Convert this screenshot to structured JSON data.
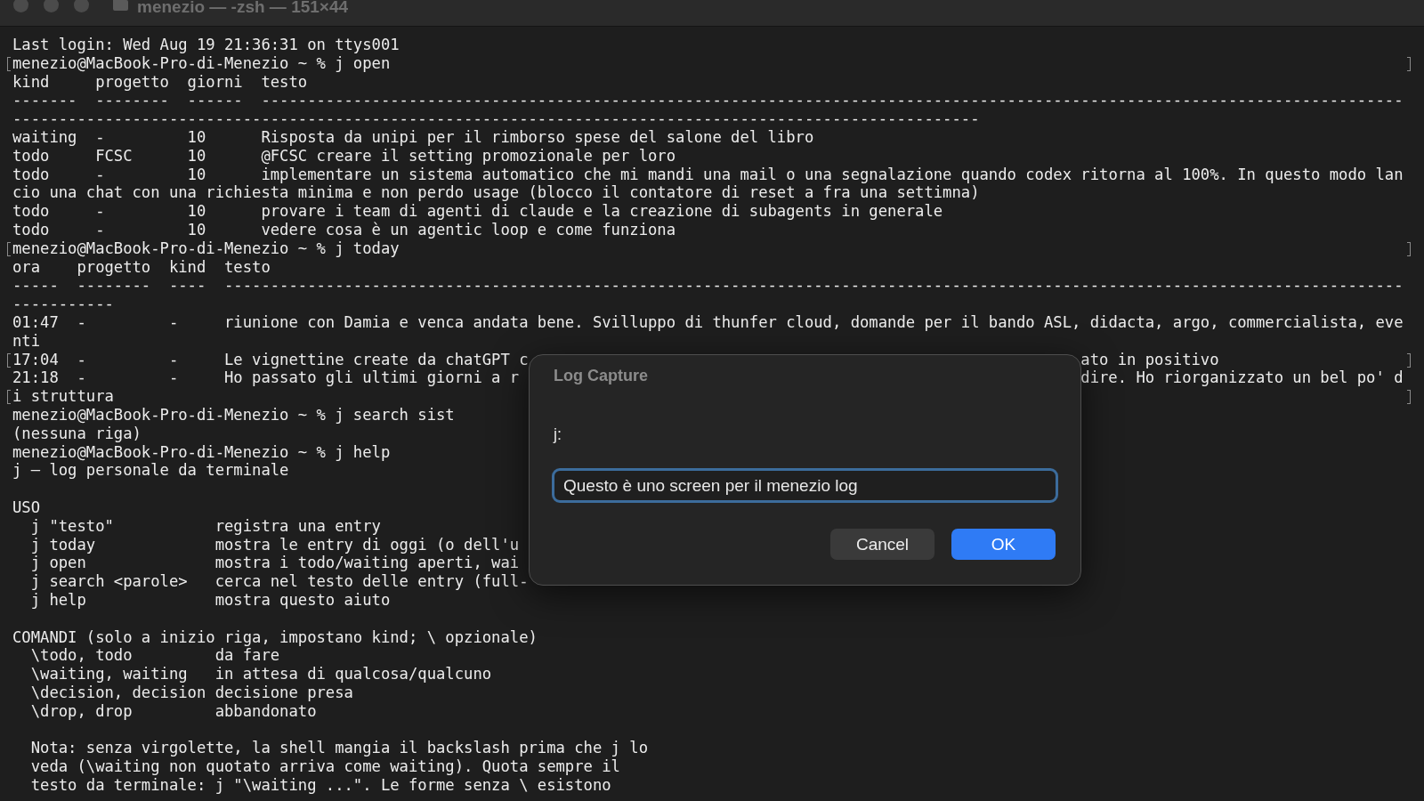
{
  "window": {
    "title": "menezio — -zsh — 151×44",
    "active": false
  },
  "lines": [
    {
      "kind": "text",
      "text": "Last login: Wed Aug 19 21:36:31 on ttys001",
      "marked": false
    },
    {
      "kind": "text",
      "text": "menezio@MacBook-Pro-di-Menezio ~ % j open",
      "marked": true
    },
    {
      "kind": "text",
      "text": "kind     progetto  giorni  testo",
      "marked": false
    },
    {
      "kind": "text",
      "text": "-------  --------  ------  ----------------------------------------------------------------------------------------------------------------------------",
      "marked": false
    },
    {
      "kind": "text",
      "text": "---------------------------------------------------------------------------------------------------------",
      "marked": false
    },
    {
      "kind": "text",
      "text": "waiting  -         10      Risposta da unipi per il rimborso spese del salone del libro",
      "marked": false
    },
    {
      "kind": "text",
      "text": "todo     FCSC      10      @FCSC creare il setting promozionale per loro",
      "marked": false
    },
    {
      "kind": "text",
      "text": "todo     -         10      implementare un sistema automatico che mi mandi una mail o una segnalazione quando codex ritorna al 100%. In questo modo lan",
      "marked": false
    },
    {
      "kind": "text",
      "text": "cio una chat con una richiesta minima e non perdo usage (blocco il contatore di reset a fra una settimna)",
      "marked": false
    },
    {
      "kind": "text",
      "text": "todo     -         10      provare i team di agenti di claude e la creazione di subagents in generale",
      "marked": false
    },
    {
      "kind": "text",
      "text": "todo     -         10      vedere cosa è un agentic loop e come funziona",
      "marked": false
    },
    {
      "kind": "text",
      "text": "menezio@MacBook-Pro-di-Menezio ~ % j today",
      "marked": true
    },
    {
      "kind": "text",
      "text": "ora    progetto  kind  testo",
      "marked": false
    },
    {
      "kind": "text",
      "text": "-----  --------  ----  --------------------------------------------------------------------------------------------------------------------------------",
      "marked": false
    },
    {
      "kind": "text",
      "text": "-----------",
      "marked": false
    },
    {
      "kind": "text",
      "text": "01:47  -         -     riunione con Damia e venca andata bene. Svilluppo di thunfer cloud, domande per il bando ASL, didacta, argo, commercialista, eve",
      "marked": false
    },
    {
      "kind": "text",
      "text": "nti",
      "marked": false
    },
    {
      "kind": "split",
      "text": "17:04  -         -     Le vignettine create da chatGPT c",
      "tail": "ato in positivo",
      "marked": true
    },
    {
      "kind": "split",
      "text": "21:18  -         -     Ho passato gli ultimi giorni a r",
      "tail": "dire. Ho riorganizzato un bel po' d",
      "marked": false
    },
    {
      "kind": "text",
      "text": "i struttura",
      "marked": true
    },
    {
      "kind": "text",
      "text": "menezio@MacBook-Pro-di-Menezio ~ % j search sist",
      "marked": false
    },
    {
      "kind": "text",
      "text": "(nessuna riga)",
      "marked": false
    },
    {
      "kind": "text",
      "text": "menezio@MacBook-Pro-di-Menezio ~ % j help",
      "marked": false
    },
    {
      "kind": "text",
      "text": "j — log personale da terminale",
      "marked": false
    },
    {
      "kind": "blank"
    },
    {
      "kind": "text",
      "text": "USO",
      "marked": false
    },
    {
      "kind": "text",
      "text": "  j \"testo\"           registra una entry",
      "marked": false
    },
    {
      "kind": "text",
      "text": "  j today             mostra le entry di oggi (o dell'u",
      "marked": false
    },
    {
      "kind": "text",
      "text": "  j open              mostra i todo/waiting aperti, wai",
      "marked": false
    },
    {
      "kind": "text",
      "text": "  j search <parole>   cerca nel testo delle entry (full-",
      "marked": false
    },
    {
      "kind": "text",
      "text": "  j help              mostra questo aiuto",
      "marked": false
    },
    {
      "kind": "blank"
    },
    {
      "kind": "text",
      "text": "COMANDI (solo a inizio riga, impostano kind; \\ opzionale)",
      "marked": false
    },
    {
      "kind": "text",
      "text": "  \\todo, todo         da fare",
      "marked": false
    },
    {
      "kind": "text",
      "text": "  \\waiting, waiting   in attesa di qualcosa/qualcuno",
      "marked": false
    },
    {
      "kind": "text",
      "text": "  \\decision, decision decisione presa",
      "marked": false
    },
    {
      "kind": "text",
      "text": "  \\drop, drop         abbandonato",
      "marked": false
    },
    {
      "kind": "blank"
    },
    {
      "kind": "text",
      "text": "  Nota: senza virgolette, la shell mangia il backslash prima che j lo",
      "marked": false
    },
    {
      "kind": "text",
      "text": "  veda (\\waiting non quotato arriva come waiting). Quota sempre il",
      "marked": false
    },
    {
      "kind": "text",
      "text": "  testo da terminale: j \"\\waiting ...\". Le forme senza \\ esistono",
      "marked": false
    }
  ],
  "dialog": {
    "title": "Log Capture",
    "label": "j:",
    "input": {
      "value": "Questo è uno screen per il menezio log",
      "focused": true
    },
    "buttons": [
      {
        "label": "Cancel",
        "kind": "secondary"
      },
      {
        "label": "OK",
        "kind": "primary"
      }
    ]
  }
}
